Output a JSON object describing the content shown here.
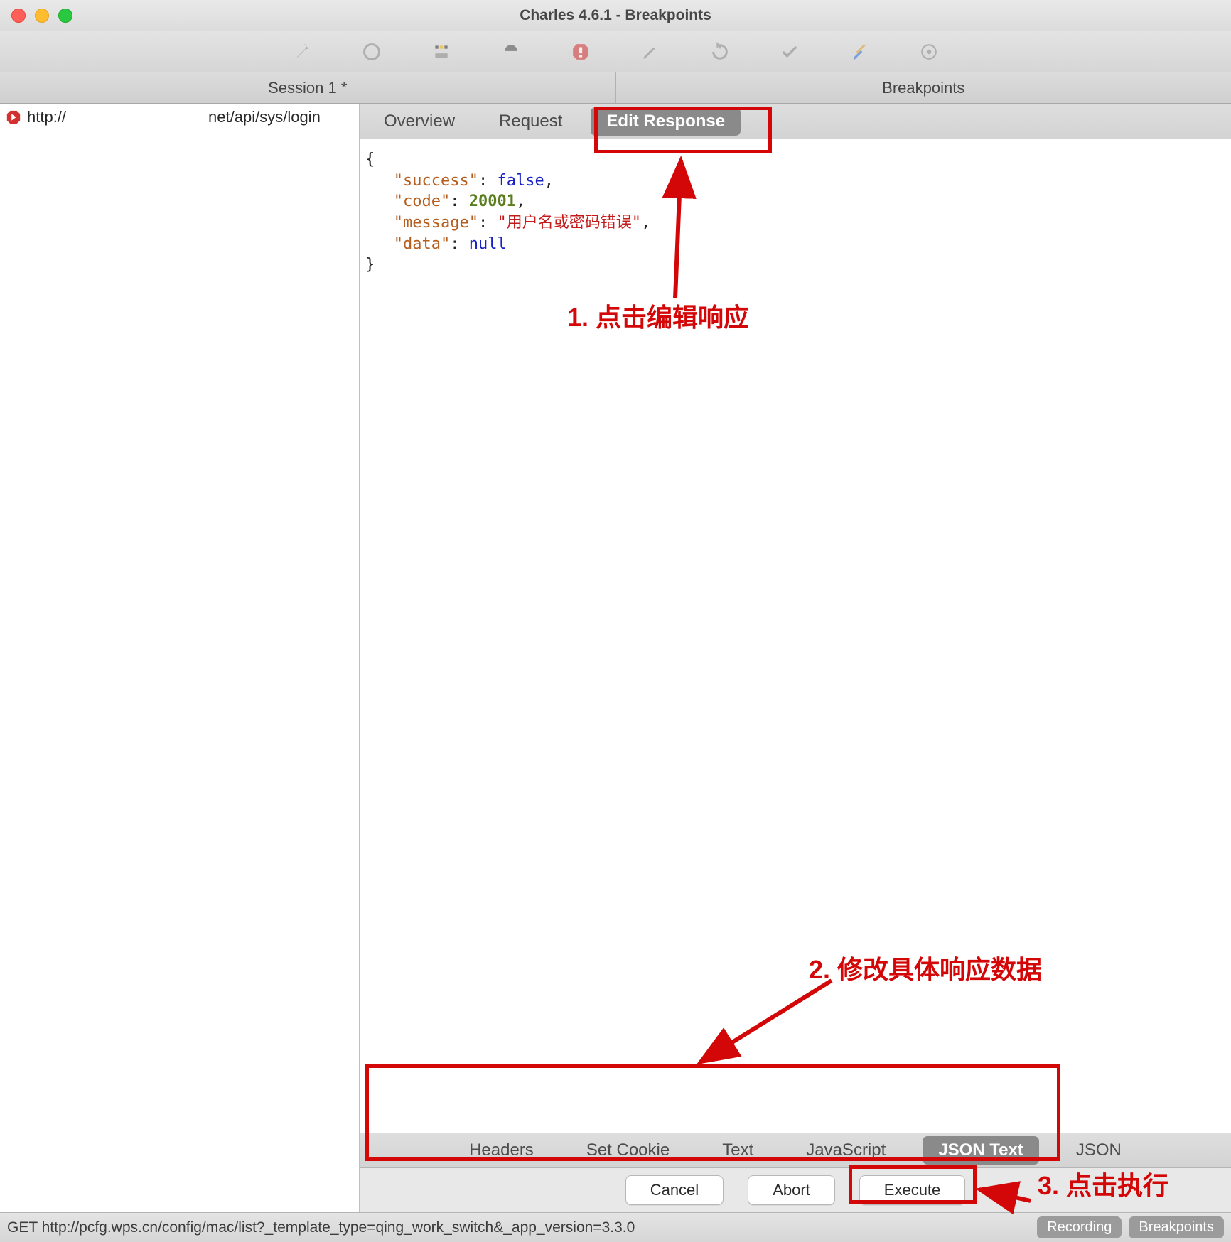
{
  "window": {
    "title": "Charles 4.6.1 - Breakpoints"
  },
  "panels": {
    "left": "Session 1 *",
    "right": "Breakpoints"
  },
  "sidebar": {
    "request_url_prefix": "http://",
    "request_url_suffix": "net/api/sys/login"
  },
  "content_tabs": {
    "overview": "Overview",
    "request": "Request",
    "edit_response": "Edit Response"
  },
  "json_body": {
    "success_key": "\"success\"",
    "success_val": "false",
    "code_key": "\"code\"",
    "code_val": "20001",
    "message_key": "\"message\"",
    "message_val": "\"用户名或密码错误\"",
    "data_key": "\"data\"",
    "data_val": "null"
  },
  "bottom_tabs": {
    "headers": "Headers",
    "set_cookie": "Set Cookie",
    "text": "Text",
    "javascript": "JavaScript",
    "json_text": "JSON Text",
    "json": "JSON"
  },
  "actions": {
    "cancel": "Cancel",
    "abort": "Abort",
    "execute": "Execute"
  },
  "status": {
    "text": "GET http://pcfg.wps.cn/config/mac/list?_template_type=qing_work_switch&_app_version=3.3.0",
    "recording": "Recording",
    "breakpoints": "Breakpoints"
  },
  "annotations": {
    "a1": "1. 点击编辑响应",
    "a2": "2. 修改具体响应数据",
    "a3": "3. 点击执行"
  }
}
